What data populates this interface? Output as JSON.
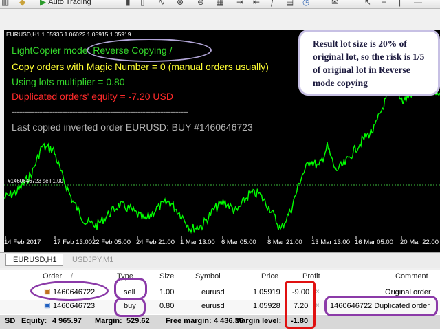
{
  "toolbar": {
    "auto_trading_label": "Auto Trading"
  },
  "chart": {
    "symbol_info": "EURUSD,H1  1.05936 1.06022 1.05915 1.05919",
    "lines": {
      "mode_prefix": "LightCopier mode: ",
      "mode_value": "Reverse Copying /",
      "magic": "Copy orders with Magic Number = 0 (manual orders usually)",
      "multiplier": "Using lots multiplier = 0.80",
      "equity": "Duplicated orders' equity = -7.20 USD",
      "separator": "----------------------------------------------------------------------",
      "last_copied": "Last copied inverted order EURUSD: BUY #1460646723"
    },
    "order_line_label": "#1460646723 sell 1.00",
    "annotation": "Result lot size is 20% of original lot, so the risk is 1/5 of original lot in Reverse mode copying",
    "x_labels": [
      "14 Feb 2017",
      "17 Feb 13:00",
      "22 Feb 05:00",
      "24 Feb 21:00",
      "1 Mar 13:00",
      "6 Mar 05:00",
      "8 Mar 21:00",
      "13 Mar 13:00",
      "16 Mar 05:00",
      "20 Mar 22:00"
    ],
    "colors": {
      "price": "#00ff00",
      "order_line": "#3dbb3d",
      "background": "#000000"
    }
  },
  "tabs": [
    {
      "label": "EURUSD,H1"
    },
    {
      "label": "USDJPY,M1"
    }
  ],
  "trade": {
    "headers": {
      "order": "Order",
      "sort_arrow": "/",
      "type": "Type",
      "size": "Size",
      "symbol": "Symbol",
      "price": "Price",
      "profit": "Profit",
      "comment": "Comment"
    },
    "rows": [
      {
        "order": "1460646722",
        "type": "sell",
        "size": "1.00",
        "symbol": "eurusd",
        "price": "1.05919",
        "profit": "-9.00",
        "close": "×",
        "comment": "Original order"
      },
      {
        "order": "1460646723",
        "type": "buy",
        "size": "0.80",
        "symbol": "eurusd",
        "price": "1.05928",
        "profit": "7.20",
        "close": "×",
        "comment": "1460646722 Duplicated order"
      }
    ],
    "status": {
      "prefix": "SD",
      "equity_label": "Equity:",
      "equity": "4 965.97",
      "margin_label": "Margin:",
      "margin": "529.62",
      "free_margin_label": "Free margin:",
      "free_margin": "4 436.36",
      "margin_level_label": "Margin level:",
      "margin_level": "-1.80"
    }
  }
}
